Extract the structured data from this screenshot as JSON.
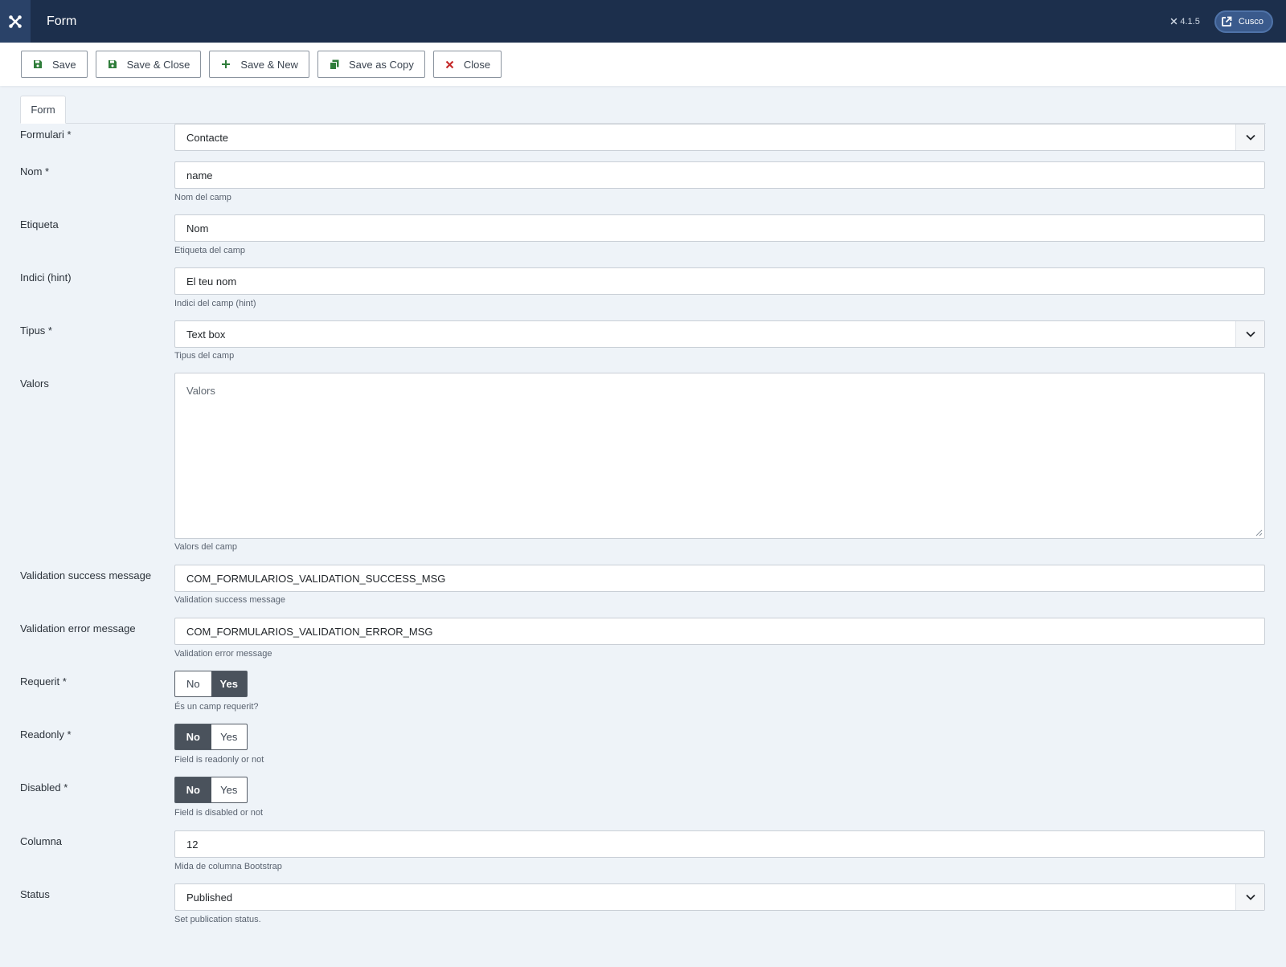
{
  "header": {
    "title": "Form",
    "version": "4.1.5",
    "site_label": "Cusco"
  },
  "toolbar": {
    "save": "Save",
    "save_close": "Save & Close",
    "save_new": "Save & New",
    "save_copy": "Save as Copy",
    "close": "Close"
  },
  "tabs": {
    "form": "Form"
  },
  "fields": {
    "formulari": {
      "label": "Formulari *",
      "value": "Contacte"
    },
    "nom": {
      "label": "Nom *",
      "value": "name",
      "help": "Nom del camp"
    },
    "etiqueta": {
      "label": "Etiqueta",
      "value": "Nom",
      "help": "Etiqueta del camp"
    },
    "indici": {
      "label": "Indici (hint)",
      "value": "El teu nom",
      "help": "Indici del camp (hint)"
    },
    "tipus": {
      "label": "Tipus *",
      "value": "Text box",
      "help": "Tipus del camp"
    },
    "valors": {
      "label": "Valors",
      "placeholder": "Valors",
      "help": "Valors del camp"
    },
    "val_success": {
      "label": "Validation success message",
      "value": "COM_FORMULARIOS_VALIDATION_SUCCESS_MSG",
      "help": "Validation success message"
    },
    "val_error": {
      "label": "Validation error message",
      "value": "COM_FORMULARIOS_VALIDATION_ERROR_MSG",
      "help": "Validation error message"
    },
    "requerit": {
      "label": "Requerit *",
      "no": "No",
      "yes": "Yes",
      "selected": "Yes",
      "help": "És un camp requerit?"
    },
    "readonly": {
      "label": "Readonly *",
      "no": "No",
      "yes": "Yes",
      "selected": "No",
      "help": "Field is readonly or not"
    },
    "disabled": {
      "label": "Disabled *",
      "no": "No",
      "yes": "Yes",
      "selected": "No",
      "help": "Field is disabled or not"
    },
    "columna": {
      "label": "Columna",
      "value": "12",
      "help": "Mida de columna Bootstrap"
    },
    "status": {
      "label": "Status",
      "value": "Published",
      "help": "Set publication status."
    }
  },
  "icons": {
    "logo": "joomla-logo-icon",
    "save": "floppy-disk-icon",
    "new": "plus-icon",
    "copy": "copy-icon",
    "close": "x-icon",
    "external": "external-link-icon",
    "chevron": "chevron-down-icon"
  },
  "colors": {
    "header_bg": "#1c2f4c",
    "save_icon": "#2f7d3a",
    "close_icon": "#c52a2a",
    "switch_active": "#4a525c"
  }
}
